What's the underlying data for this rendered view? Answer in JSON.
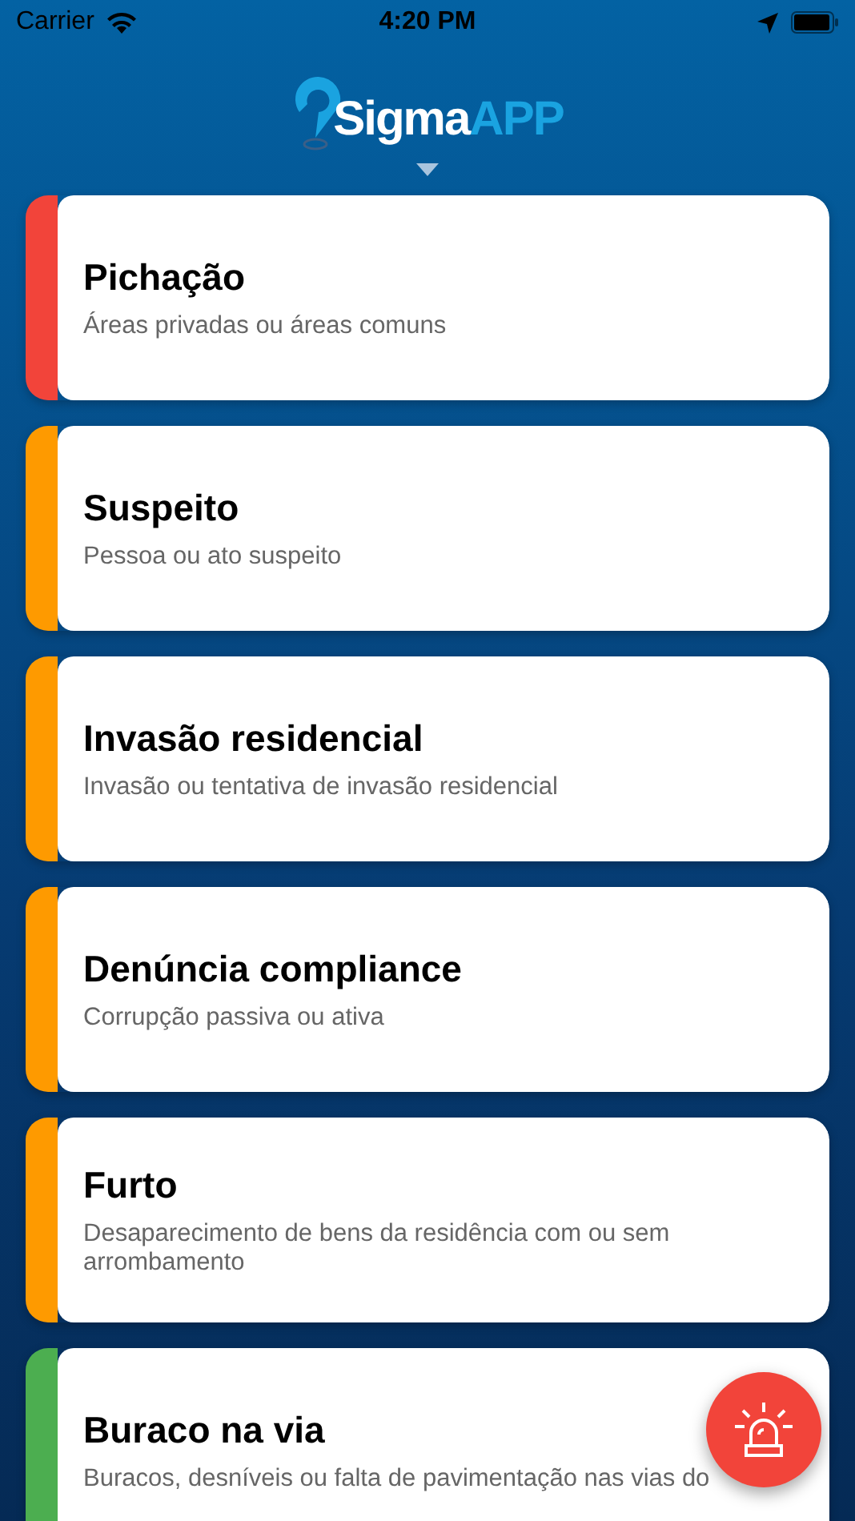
{
  "status_bar": {
    "carrier": "Carrier",
    "time": "4:20 PM"
  },
  "header": {
    "logo": [
      "Sigma",
      "APP"
    ]
  },
  "categories": [
    {
      "title": "Pichação",
      "description": "Áreas privadas ou áreas comuns",
      "color": "#f2443a"
    },
    {
      "title": "Suspeito",
      "description": "Pessoa ou ato suspeito",
      "color": "#fe9a00"
    },
    {
      "title": "Invasão residencial",
      "description": "Invasão ou tentativa de invasão residencial",
      "color": "#fe9a00"
    },
    {
      "title": "Denúncia compliance",
      "description": "Corrupção passiva ou ativa",
      "color": "#fe9a00"
    },
    {
      "title": "Furto",
      "description": "Desaparecimento de bens da residência com ou sem arrombamento",
      "color": "#fe9a00"
    },
    {
      "title": "Buraco na via",
      "description": "Buracos, desníveis ou falta de pavimentação nas vias do",
      "color": "#4cae50"
    }
  ]
}
